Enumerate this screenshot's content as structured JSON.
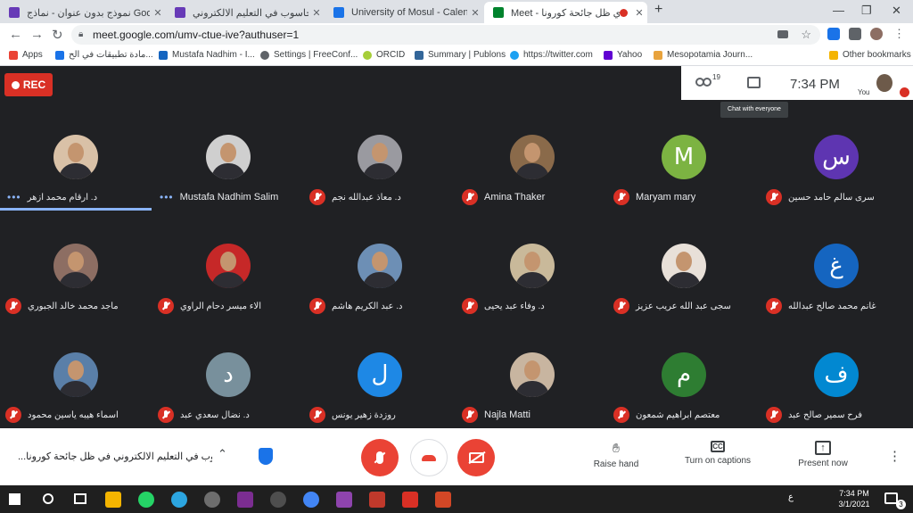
{
  "tabs": [
    {
      "title": "نموذج بدون عنوان - نماذج Google",
      "color": "#673ab7",
      "active": false
    },
    {
      "title": "دور الحاسوب في التعليم الالكتروني",
      "color": "#673ab7",
      "active": false
    },
    {
      "title": "University of Mosul - Calendar -",
      "color": "#1a73e8",
      "active": false
    },
    {
      "title": "Meet - دي ظل جائحة كورونا",
      "color": "#00832d",
      "active": true
    }
  ],
  "window_controls": {
    "new_tab": "+",
    "minimize": "—",
    "restore": "❐",
    "close": "✕"
  },
  "address": {
    "url": "meet.google.com/umv-ctue-ive?authuser=1"
  },
  "bookmarks": [
    {
      "label": "Apps",
      "color": "#ea4335"
    },
    {
      "label": "مادة تطبيقات في الح...",
      "color": "#1a73e8"
    },
    {
      "label": "Mustafa Nadhim - I...",
      "color": "#1565c0"
    },
    {
      "label": "Settings | FreeConf...",
      "color": "#5f6368"
    },
    {
      "label": "ORCID",
      "color": "#a6ce39"
    },
    {
      "label": "Summary | Publons",
      "color": "#336699"
    },
    {
      "label": "https://twitter.com",
      "color": "#1da1f2"
    },
    {
      "label": "Yahoo",
      "color": "#6001d2"
    },
    {
      "label": "Mesopotamia Journ...",
      "color": "#e8a33d"
    },
    {
      "label": "Other bookmarks",
      "color": "#f4b400"
    }
  ],
  "meet": {
    "rec_label": "REC",
    "participant_count": "19",
    "time": "7:34 PM",
    "you_label": "You",
    "chat_tooltip": "Chat with everyone"
  },
  "participants": [
    [
      {
        "name": "د. ارقام محمد ازهر",
        "avatar": "photo",
        "state": "speaking",
        "color": "#d9c1a7"
      },
      {
        "name": "Mustafa Nadhim Salim",
        "avatar": "photo",
        "state": "on",
        "color": "#cfcfcf"
      },
      {
        "name": "د. معاذ عبدالله نجم",
        "avatar": "photo",
        "state": "muted",
        "color": "#9a9aa0"
      },
      {
        "name": "Amina Thaker",
        "avatar": "photo",
        "state": "muted",
        "color": "#8a6a4a"
      },
      {
        "name": "Maryam mary",
        "avatar": "letter",
        "letter": "M",
        "color": "#7cb342",
        "state": "muted"
      },
      {
        "name": "سرى سالم حامد حسين",
        "avatar": "letter",
        "letter": "س",
        "color": "#5e35b1",
        "state": "muted"
      }
    ],
    [
      {
        "name": "ماجد محمد خالد الجبوري",
        "avatar": "photo",
        "state": "muted",
        "color": "#8d6e63"
      },
      {
        "name": "الاء ميسر دحام الراوي",
        "avatar": "photo",
        "state": "muted",
        "color": "#c62828"
      },
      {
        "name": "د. عبد الكريم هاشم",
        "avatar": "photo",
        "state": "muted",
        "color": "#6d8fb5"
      },
      {
        "name": "د. وفاء عبد يحيى",
        "avatar": "photo",
        "state": "muted",
        "color": "#c9b99a"
      },
      {
        "name": "سجى عبد الله عريب عزيز",
        "avatar": "photo",
        "state": "muted",
        "color": "#e8e0d8"
      },
      {
        "name": "غانم محمد صالح عبدالله",
        "avatar": "letter",
        "letter": "غ",
        "color": "#1565c0",
        "state": "muted"
      }
    ],
    [
      {
        "name": "اسماء هيبه ياسين محمود",
        "avatar": "photo",
        "state": "muted",
        "color": "#5a7fa8"
      },
      {
        "name": "د. نضال سعدي عبد",
        "avatar": "letter",
        "letter": "د",
        "color": "#78909c",
        "state": "muted"
      },
      {
        "name": "روزدة زهير يونس",
        "avatar": "letter",
        "letter": "ل",
        "color": "#1e88e5",
        "state": "muted"
      },
      {
        "name": "Najla Matti",
        "avatar": "photo",
        "state": "muted",
        "color": "#c8b5a0"
      },
      {
        "name": "معتصم ابراهيم شمعون",
        "avatar": "letter",
        "letter": "م",
        "color": "#2e7d32",
        "state": "muted"
      },
      {
        "name": "فرح سمير صالح عبد",
        "avatar": "letter",
        "letter": "ف",
        "color": "#0288d1",
        "state": "muted"
      }
    ]
  ],
  "bottom": {
    "meeting_title": "...وب في التعليم الالكتروني في ظل جائحة كورونا",
    "raise_hand": "Raise hand",
    "captions": "Turn on captions",
    "present": "Present now"
  },
  "taskbar": {
    "time": "7:34 PM",
    "date": "3/1/2021",
    "lang": "ع",
    "notif": "3"
  }
}
